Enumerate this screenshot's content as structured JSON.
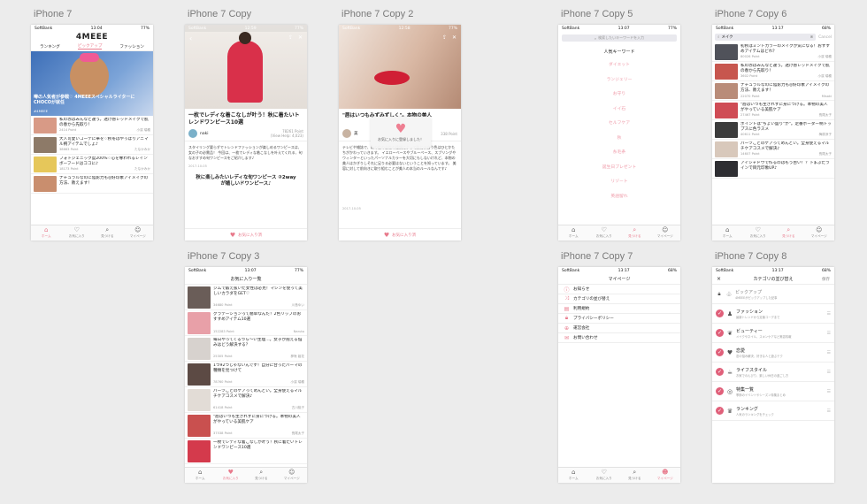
{
  "artboards": {
    "home": "iPhone 7",
    "copy": "iPhone 7 Copy",
    "copy2": "iPhone 7 Copy 2",
    "copy5": "iPhone 7 Copy 5",
    "copy6": "iPhone 7 Copy 6",
    "copy3": "iPhone 7 Copy 3",
    "copy7": "iPhone 7 Copy 7",
    "copy8": "iPhone 7 Copy 8"
  },
  "status": {
    "carrier": "SoftBank",
    "time1": "13:04",
    "time2": "12:59",
    "time3": "12:58",
    "time4": "13:07",
    "time5": "13:17",
    "battery": "77%",
    "battery2": "68%"
  },
  "tabs": {
    "home": "ホーム",
    "fav": "お気に入り",
    "search": "見つける",
    "my": "マイページ"
  },
  "colors": {
    "accent": "#e87a8c"
  },
  "home": {
    "logo": "4MEEE",
    "tabs": [
      "ランキング",
      "ピックアップ",
      "ファッション"
    ],
    "hero_text": "噂の人気者が参戦♡ 4MEEEスペシャルライターに CHOCOが就任",
    "hero_tag": "#4MEEE",
    "items": [
      {
        "title": "私の赤はみんなと違う。透け感レッドメイクで肌の春から先取り！",
        "pt": "2414 Point",
        "author": "小濱 瑞穂"
      },
      {
        "title": "大人可愛いコーデに華を♡秋冬はやっぱりアニマル柄アイテムでしょ♪",
        "pt": "38663 Point",
        "author": "たなかみか"
      },
      {
        "title": "フォトジェニック度200%♡心を奪われるレインボーフードはココに♪",
        "pt": "18173 Point",
        "author": "たなかみか"
      },
      {
        "title": "ナチュラルなのに陰影力も◎好印象アイメイクの方法、教えます！",
        "pt": "",
        "author": ""
      }
    ]
  },
  "article": {
    "title": "一枚でレディな着こなしが叶う！秋に着たいトレンドワンピース10選",
    "author": "naki",
    "pt": "78261 Point",
    "views": "(View Help: 4,023)",
    "body": "スタイリング要らずでトレンドファッションが楽しめるワンピースは、女の子の必需品！ 今回は、一枚でレディな着こなしを叶えてくれる、旬なおすすめ旬ワンピースをご紹介します♪",
    "date": "2017-10-05",
    "next": "秋に楽しみたいレディな旬ワンピース ②2wayが嬉しいドワンピース♪",
    "fav_button": "お気に入り済"
  },
  "article2": {
    "title": "\"唇はいつもみずみずしく\"。本物の美人",
    "tail": "本物",
    "author": "美",
    "pt": "338 Point",
    "toast": "お気に入りに登録しました！",
    "body": "テレビや雑誌で、私の色の合性の種類によって肌に似合う色はひとかたちがかわっていきます。 イエローベースやブルーベース、スプリングやウィンターといったパーソナルカラーを大切にもしないけれど、本物の美人はかぎりしそれに足りる必要はないということを知っています。 美容に対して前向きに取り組むことが美人の本当のルールなんです♪",
    "date": "2017-10-05",
    "fav_button": "お気に入り済"
  },
  "keywords": {
    "search_placeholder": "検索したいキーワードを入力",
    "heading": "人気キーワード",
    "list": [
      "ダイエット",
      "ランジェリー",
      "お守り",
      "イイ石",
      "セルフケア",
      "秋",
      "糸毛条",
      "誕生日プレゼント",
      "リゾート",
      "英語留れ"
    ]
  },
  "results": {
    "query": "メイク",
    "cancel": "Cancel",
    "items": [
      {
        "title": "初秋はミントカラーのメイクが気になる！おすすめアイテムはどれ？",
        "pt": "80026 Point",
        "author": "小濱 瑞穂"
      },
      {
        "title": "私の赤はみんなと違う。透け感レッドメイクで肌の春から先取り！",
        "pt": "3602 Point",
        "author": "小濱 瑞穂"
      },
      {
        "title": "ナチュラルなのに陰影力も◎好印象アイメイクの方法、教えます！",
        "pt": "22070 Point",
        "author": "Misaki"
      },
      {
        "title": "\"唇はいつも生きれずに身につける。本物の美人がやっている美肌ケア",
        "pt": "27467 Point",
        "author": "長尾太子"
      },
      {
        "title": "ポイントは\"ちょい盛り\"が\"。定番ボーダー柄トップスに色ラスメ",
        "pt": "40611 Point",
        "author": "梅原涼子"
      },
      {
        "title": "パーツごとのケアってめんどい。全身使えるマルチケアコスメで解決♪",
        "pt": "14607 Point",
        "author": "長尾太子"
      },
      {
        "title": "アイシャドウで作るのはもう古い！？下まぶたラインで目元印象UP♪",
        "pt": "",
        "author": ""
      }
    ]
  },
  "favorites": {
    "heading": "お気に入り一覧",
    "items": [
      {
        "title": "ジムで鍛え抜いた女性は必見！マシンを使って美しいカラダをGET♡",
        "pt": "34680 Point",
        "author": "川島ゆい"
      },
      {
        "title": "グラデーションって簡単なんだ！2色リップのおすすめアイテム10選",
        "pt": "152283 Point",
        "author": "Naruto"
      },
      {
        "title": "毎日やってくるつら〜い生理…。女子が抱える悩みはどう解決する？",
        "pt": "25305 Point",
        "author": "夢咲 姫花"
      },
      {
        "title": "1つ92つじゃないんです！自分に合ったパーマの種類を見つけて",
        "pt": "78760 Point",
        "author": "小濱 瑞穂"
      },
      {
        "title": "パーツごとのケアってめんどい。全身使えるマルチケアコスメで解決♪",
        "pt": "61418 Point",
        "author": "古川桃子"
      },
      {
        "title": "\"唇はいつも生きれずに身につける。本物の美人がやっている美肌ケア",
        "pt": "37538 Point",
        "author": "長尾太子"
      },
      {
        "title": "一枚でレディな着こなしが叶う！秋に着たいトレンドワンピース10選",
        "pt": "",
        "author": ""
      }
    ]
  },
  "mypage": {
    "heading": "マイページ",
    "items": [
      "お知らせ",
      "カテゴリの並び替え",
      "利用規約",
      "プライバシーポリシー",
      "運営会社",
      "お問い合わせ"
    ]
  },
  "categories": {
    "heading": "カテゴリの並び替え",
    "close": "×",
    "save": "保存",
    "items": [
      {
        "name": "ピックアップ",
        "sub": "4MEEEがピックアップした記事"
      },
      {
        "name": "ファッション",
        "sub": "最新トレンドから定番コーデまで"
      },
      {
        "name": "ビューティー",
        "sub": "メイクやネイル、スキンケアなど美容情報"
      },
      {
        "name": "恋愛",
        "sub": "恋の悩み解決、好きな人と遊ぶテク"
      },
      {
        "name": "ライフスタイル",
        "sub": "お家でのんびり、楽しい休日の過ごし方"
      },
      {
        "name": "特集一覧",
        "sub": "季節のイベントやシーズン特集まとめ"
      },
      {
        "name": "ランキング",
        "sub": "人気のランキングをチェック"
      }
    ]
  }
}
